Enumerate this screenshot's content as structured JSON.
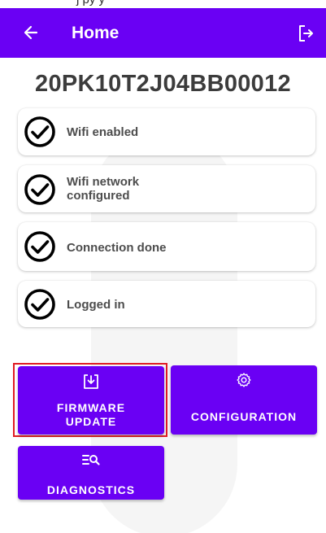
{
  "status_strip_text": "j py y",
  "app_bar": {
    "title": "Home",
    "back_icon": "arrow-left-icon",
    "logout_icon": "logout-icon",
    "color": "#6a00f4"
  },
  "device": {
    "serial": "20PK10T2J04BB00012"
  },
  "steps": [
    {
      "label": "Wifi enabled",
      "icon": "check-circle-icon"
    },
    {
      "label": "Wifi network configured",
      "icon": "check-circle-icon"
    },
    {
      "label": "Connection done",
      "icon": "check-circle-icon"
    },
    {
      "label": "Logged in",
      "icon": "check-circle-icon"
    }
  ],
  "actions": {
    "firmware_update": {
      "label": "FIRMWARE UPDATE",
      "icon": "download-icon",
      "highlighted": true,
      "highlight_color": "#e01b24"
    },
    "configuration": {
      "label": "CONFIGURATION",
      "icon": "gear-icon"
    },
    "diagnostics": {
      "label": "DIAGNOSTICS",
      "icon": "list-search-icon"
    }
  }
}
